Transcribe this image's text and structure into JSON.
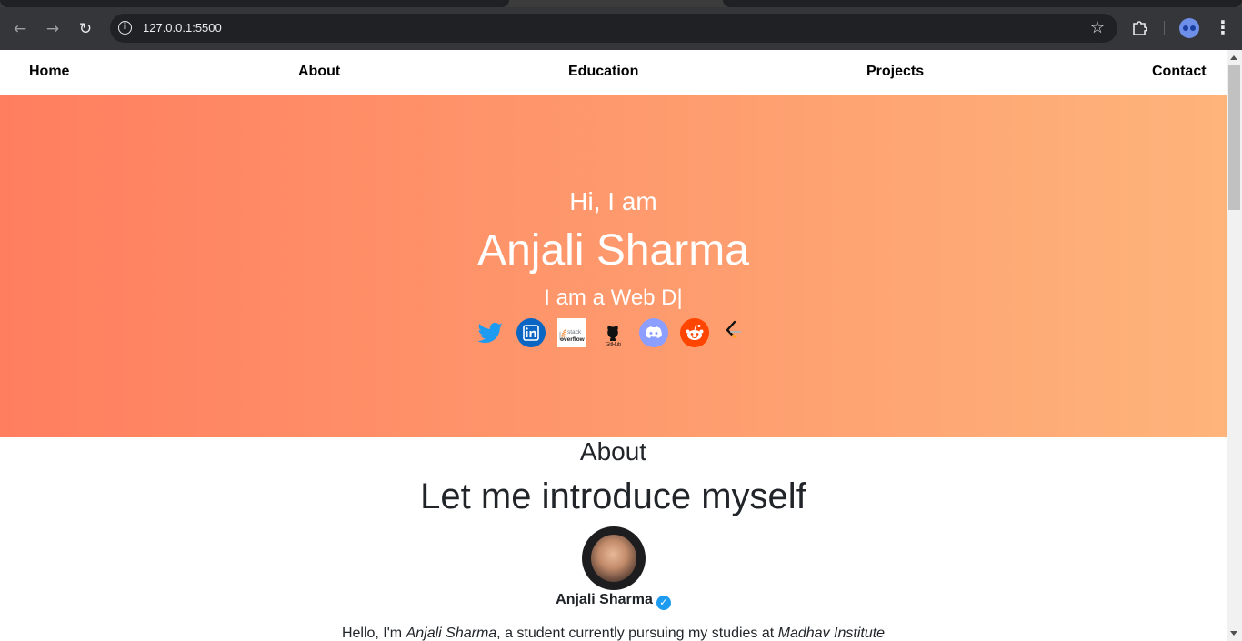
{
  "browser": {
    "url": "127.0.0.1:5500"
  },
  "nav": {
    "home": "Home",
    "about": "About",
    "education": "Education",
    "projects": "Projects",
    "contact": "Contact"
  },
  "hero": {
    "greeting": "Hi, I am",
    "name": "Anjali Sharma",
    "typed_text": "I am a Web D|",
    "socials": [
      "twitter-icon",
      "linkedin-icon",
      "stackoverflow-icon",
      "github-icon",
      "discord-icon",
      "reddit-icon",
      "leetcode-icon"
    ]
  },
  "about": {
    "label": "About",
    "heading": "Let me introduce myself",
    "profile_name": "Anjali Sharma",
    "intro_prefix": "Hello, I'm ",
    "intro_name": "Anjali Sharma",
    "intro_middle": ", a student currently pursuing my studies at ",
    "intro_institute": "Madhav Institute"
  },
  "colors": {
    "hero_start": "#ff7e5f",
    "hero_end": "#feb47b"
  }
}
